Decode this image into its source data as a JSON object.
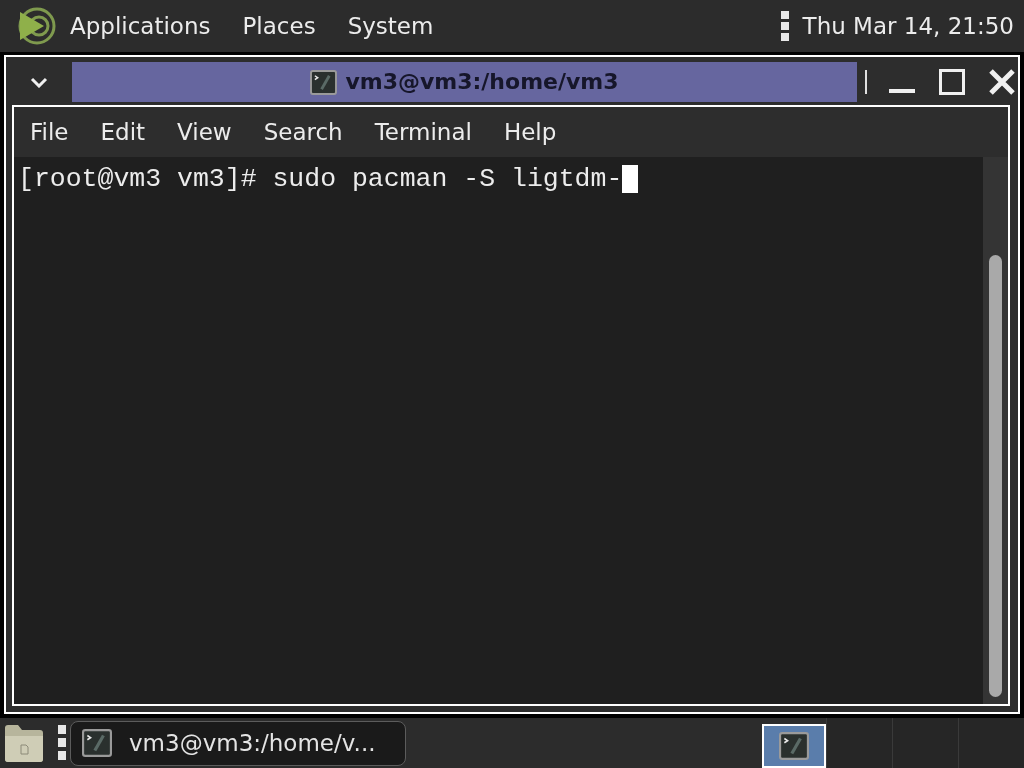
{
  "top_panel": {
    "menus": [
      "Applications",
      "Places",
      "System"
    ],
    "clock": "Thu Mar 14, 21:50"
  },
  "window": {
    "title": "vm3@vm3:/home/vm3",
    "menu": [
      "File",
      "Edit",
      "View",
      "Search",
      "Terminal",
      "Help"
    ]
  },
  "terminal": {
    "lines": [
      "[root@vm3 vm3]# sudo pacman -S ligtdm-"
    ],
    "cursor": true
  },
  "taskbar": {
    "tasks": [
      {
        "label": "vm3@vm3:/home/v..."
      }
    ],
    "workspaces": [
      {
        "selected": true,
        "has_window": true
      },
      {
        "selected": false,
        "has_window": false
      },
      {
        "selected": false,
        "has_window": false
      },
      {
        "selected": false,
        "has_window": false
      }
    ]
  }
}
